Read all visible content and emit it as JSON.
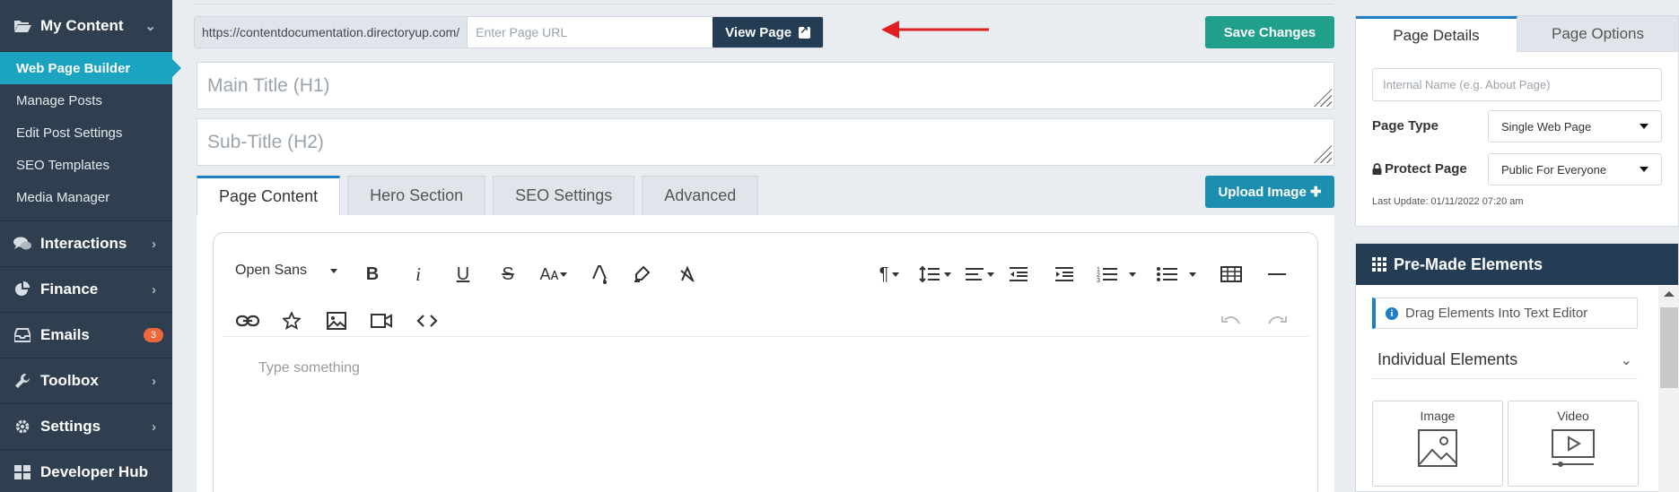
{
  "sidebar": {
    "my_content": {
      "label": "My Content",
      "icon": "folder-open-icon"
    },
    "sub_items": [
      {
        "label": "Web Page Builder",
        "active": true
      },
      {
        "label": "Manage Posts"
      },
      {
        "label": "Edit Post Settings"
      },
      {
        "label": "SEO Templates"
      },
      {
        "label": "Media Manager"
      }
    ],
    "sections": [
      {
        "label": "Interactions",
        "icon": "comments-icon"
      },
      {
        "label": "Finance",
        "icon": "pie-chart-icon"
      },
      {
        "label": "Emails",
        "icon": "inbox-icon",
        "badge": "3"
      },
      {
        "label": "Toolbox",
        "icon": "wrench-icon"
      },
      {
        "label": "Settings",
        "icon": "gear-icon"
      },
      {
        "label": "Developer Hub",
        "icon": "grid-icon"
      }
    ]
  },
  "url_bar": {
    "prefix": "https://contentdocumentation.directoryup.com/",
    "placeholder": "Enter Page URL",
    "view_label": "View Page"
  },
  "save_label": "Save Changes",
  "fields": {
    "main_title_placeholder": "Main Title (H1)",
    "sub_title_placeholder": "Sub-Title (H2)"
  },
  "tabs": [
    "Page Content",
    "Hero Section",
    "SEO Settings",
    "Advanced"
  ],
  "upload_label": "Upload Image",
  "editor": {
    "font": "Open Sans",
    "placeholder": "Type something"
  },
  "right_panel": {
    "tabs": [
      "Page Details",
      "Page Options"
    ],
    "internal_name_placeholder": "Internal Name (e.g. About Page)",
    "page_type_label": "Page Type",
    "page_type_value": "Single Web Page",
    "protect_label": "Protect Page",
    "protect_value": "Public For Everyone",
    "last_update": "Last Update: 01/11/2022 07:20 am"
  },
  "premade": {
    "title": "Pre-Made Elements",
    "drag_info": "Drag Elements Into Text Editor",
    "individual": "Individual Elements",
    "elements": [
      "Image",
      "Video"
    ]
  },
  "colors": {
    "sidebar_bg": "#2f3f4f",
    "active_accent": "#1ba3c2",
    "dark_navy": "#243d55",
    "save_green": "#20a08b",
    "arrow_red": "#e02020"
  }
}
